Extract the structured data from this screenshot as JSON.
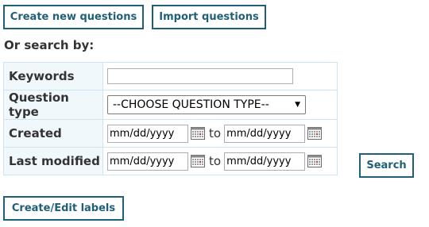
{
  "toolbar": {
    "create_questions_label": "Create new questions",
    "import_questions_label": "Import questions"
  },
  "search": {
    "heading": "Or search by:",
    "keywords": {
      "label": "Keywords",
      "value": ""
    },
    "question_type": {
      "label": "Question type",
      "selected": "--CHOOSE QUESTION TYPE--"
    },
    "created": {
      "label": "Created",
      "from_placeholder": "mm/dd/yyyy",
      "to_label": "to",
      "to_placeholder": "mm/dd/yyyy"
    },
    "last_modified": {
      "label": "Last modified",
      "from_placeholder": "mm/dd/yyyy",
      "to_label": "to",
      "to_placeholder": "mm/dd/yyyy"
    },
    "search_label": "Search"
  },
  "labels": {
    "create_edit_label": "Create/Edit labels"
  },
  "colors": {
    "button_border": "#1f5f78",
    "label_cell_bg": "#f0f8fc",
    "table_border": "#cde6f2"
  },
  "icons": {
    "calendar": "calendar-icon",
    "dropdown": "chevron-down-icon"
  }
}
